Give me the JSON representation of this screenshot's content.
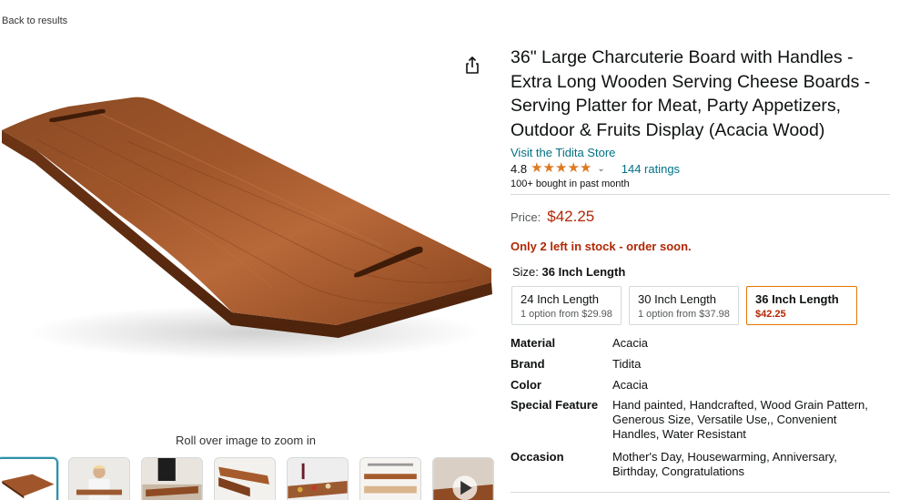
{
  "nav": {
    "back_label": "Back to results"
  },
  "share": {
    "icon": "share-icon"
  },
  "gallery": {
    "zoom_hint": "Roll over image to zoom in",
    "thumbnails": [
      {
        "name": "thumbnail-board-main",
        "selected": true
      },
      {
        "name": "thumbnail-person-holding-board",
        "selected": false
      },
      {
        "name": "thumbnail-board-on-table",
        "selected": false
      },
      {
        "name": "thumbnail-board-angle",
        "selected": false
      },
      {
        "name": "thumbnail-board-with-food",
        "selected": false
      },
      {
        "name": "thumbnail-board-dimensions",
        "selected": false
      },
      {
        "name": "thumbnail-video",
        "selected": false
      }
    ]
  },
  "product": {
    "title": "36\" Large Charcuterie Board with Handles - Extra Long Wooden Serving Cheese Boards - Serving Platter for Meat, Party Appetizers, Outdoor & Fruits Display (Acacia Wood)",
    "store_link": "Visit the Tidita Store",
    "rating_value": "4.8",
    "ratings_count": "144 ratings",
    "bought_text": "100+ bought in past month",
    "price_label": "Price:",
    "price": "$42.25",
    "stock_message": "Only 2 left in stock - order soon.",
    "size_label": "Size:",
    "size_selected": "36 Inch Length",
    "sizes": [
      {
        "name": "24 Inch Length",
        "sub": "1 option from $29.98"
      },
      {
        "name": "30 Inch Length",
        "sub": "1 option from $37.98"
      },
      {
        "name": "36 Inch Length",
        "sub": "$42.25"
      }
    ],
    "specs": [
      {
        "key": "Material",
        "value": "Acacia"
      },
      {
        "key": "Brand",
        "value": "Tidita"
      },
      {
        "key": "Color",
        "value": "Acacia"
      },
      {
        "key": "Special Feature",
        "value": "Hand painted, Handcrafted, Wood Grain Pattern, Generous Size, Versatile Use,, Convenient Handles, Water Resistant"
      },
      {
        "key": "Occasion",
        "value": "Mother's Day, Housewarming, Anniversary, Birthday, Congratulations"
      }
    ]
  },
  "colors": {
    "link": "#007185",
    "price": "#b12704",
    "star": "#de7921",
    "selected_border": "#e77600"
  }
}
